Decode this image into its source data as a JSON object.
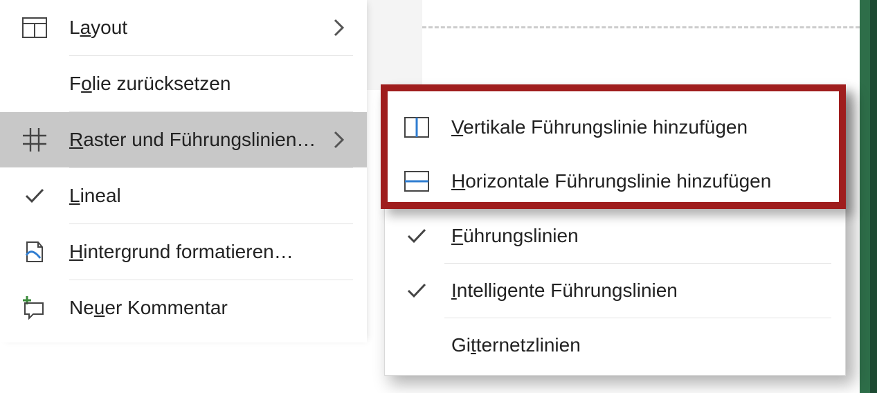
{
  "menu1": {
    "layout": {
      "label": "Layout",
      "has_submenu": true
    },
    "reset_slide": {
      "label": "Folie zurücksetzen"
    },
    "grid_guides": {
      "label": "Raster und Führungslinien…",
      "has_submenu": true,
      "active": true
    },
    "ruler": {
      "label": "Lineal",
      "checked": true
    },
    "format_bg": {
      "label": "Hintergrund formatieren…"
    },
    "new_comment": {
      "label": "Neuer Kommentar"
    }
  },
  "menu2": {
    "add_vguide": {
      "label": "Vertikale Führungslinie hinzufügen"
    },
    "add_hguide": {
      "label": "Horizontale Führungslinie hinzufügen"
    },
    "guides": {
      "label": "Führungslinien",
      "checked": true
    },
    "smart_guides": {
      "label": "Intelligente Führungslinien",
      "checked": true
    },
    "gridlines": {
      "label": "Gitternetzlinien"
    }
  },
  "underline": {
    "layout": "L<u>a</u>yout",
    "reset_slide": "F<u>o</u>lie zurücksetzen",
    "grid_guides": "<u>R</u>aster und Führungslinien…",
    "ruler": "<u>L</u>ineal",
    "format_bg": "<u>H</u>intergrund formatieren…",
    "new_comment": "Ne<u>u</u>er Kommentar",
    "add_vguide": "<u>V</u>ertikale Führungslinie hinzufügen",
    "add_hguide": "<u>H</u>orizontale Führungslinie hinzufügen",
    "guides": "<u>F</u>ührungslinien",
    "smart_guides": "<u>I</u>ntelligente Führungslinien",
    "gridlines": "Gi<u>t</u>ternetzlinien"
  }
}
